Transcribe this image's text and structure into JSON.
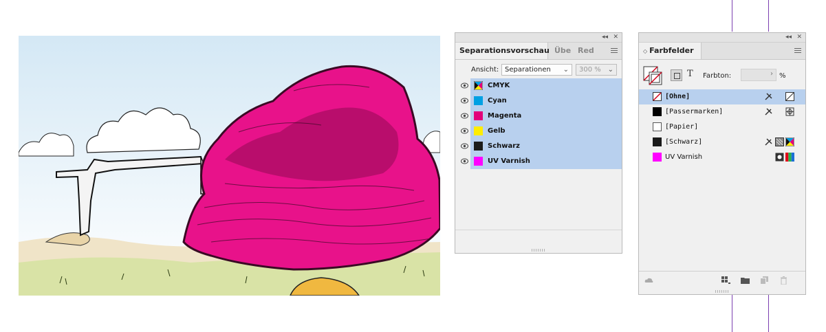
{
  "separation_panel": {
    "tabs": [
      "Separationsvorschau",
      "Übe",
      "Red"
    ],
    "view_label": "Ansicht:",
    "view_value": "Separationen",
    "zoom_value": "300 %",
    "plates": [
      {
        "name": "CMYK",
        "color": "cmyk"
      },
      {
        "name": "Cyan",
        "color": "#00a0e3"
      },
      {
        "name": "Magenta",
        "color": "#e2007a"
      },
      {
        "name": "Gelb",
        "color": "#ffed00"
      },
      {
        "name": "Schwarz",
        "color": "#1d1d1b"
      },
      {
        "name": "UV Varnish",
        "color": "#ff00ff"
      }
    ]
  },
  "swatches_panel": {
    "tab": "Farbfelder",
    "tint_label": "Farbton:",
    "tint_unit": "%",
    "swatches": [
      {
        "name": "[Ohne]",
        "color": "none",
        "selected": true
      },
      {
        "name": "[Passermarken]",
        "color": "#000000"
      },
      {
        "name": "[Papier]",
        "color": "#ffffff"
      },
      {
        "name": "[Schwarz]",
        "color": "#1a1a1a"
      },
      {
        "name": "UV Varnish",
        "color": "#ff00ff"
      }
    ]
  },
  "colors": {
    "highlight": "#b8d0ee",
    "artwork_magenta": "#e8128a",
    "guide": "#7b3fb0"
  }
}
